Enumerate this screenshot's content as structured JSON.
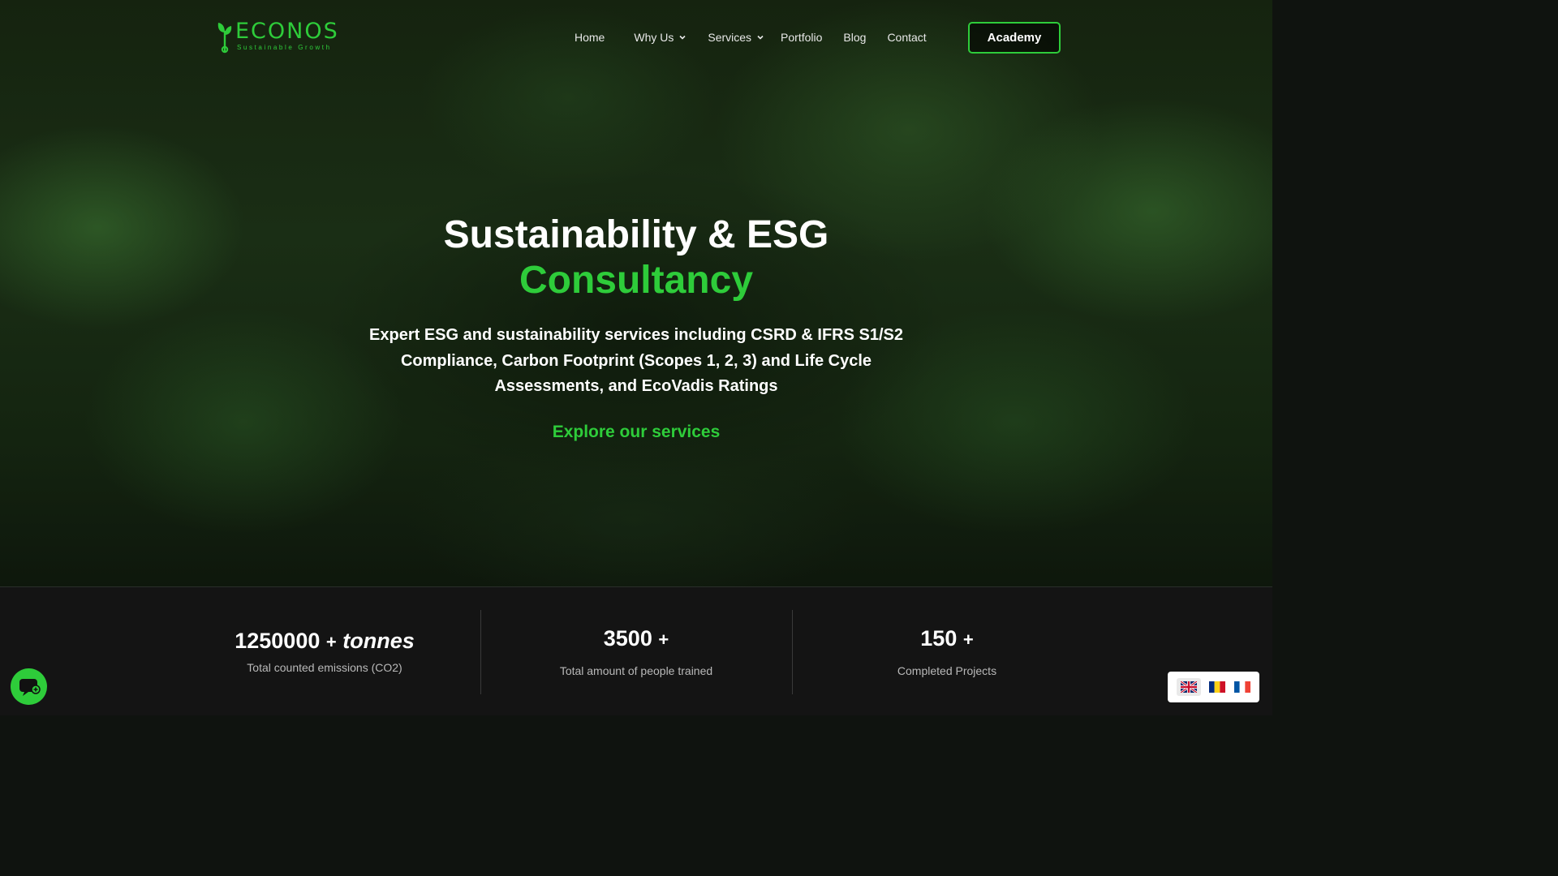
{
  "brand": {
    "name": "ECONOS",
    "tagline": "Sustainable Growth",
    "accent_color": "#2ecc3a"
  },
  "nav": {
    "items": [
      {
        "label": "Home",
        "has_dropdown": false
      },
      {
        "label": "Why Us",
        "has_dropdown": true
      },
      {
        "label": "Services",
        "has_dropdown": true
      },
      {
        "label": "Portfolio",
        "has_dropdown": false
      },
      {
        "label": "Blog",
        "has_dropdown": false
      },
      {
        "label": "Contact",
        "has_dropdown": false
      }
    ],
    "cta_label": "Academy"
  },
  "hero": {
    "title_line1": "Sustainability & ESG",
    "title_line2": "Consultancy",
    "subtitle": "Expert ESG and sustainability services including CSRD & IFRS S1/S2 Compliance, Carbon Footprint (Scopes 1, 2, 3) and Life Cycle Assessments, and EcoVadis Ratings",
    "cta_label": "Explore our services"
  },
  "stats": [
    {
      "value": "1250000",
      "plus": "+",
      "unit": "tonnes",
      "label": "Total counted emissions (CO2)"
    },
    {
      "value": "3500",
      "plus": "+",
      "unit": "",
      "label": "Total amount of people trained"
    },
    {
      "value": "150",
      "plus": "+",
      "unit": "",
      "label": "Completed Projects"
    }
  ],
  "chat": {
    "icon": "chat-icon"
  },
  "languages": [
    {
      "code": "en",
      "icon": "flag-uk-icon"
    },
    {
      "code": "ro",
      "icon": "flag-romania-icon"
    },
    {
      "code": "fr",
      "icon": "flag-france-icon"
    }
  ]
}
